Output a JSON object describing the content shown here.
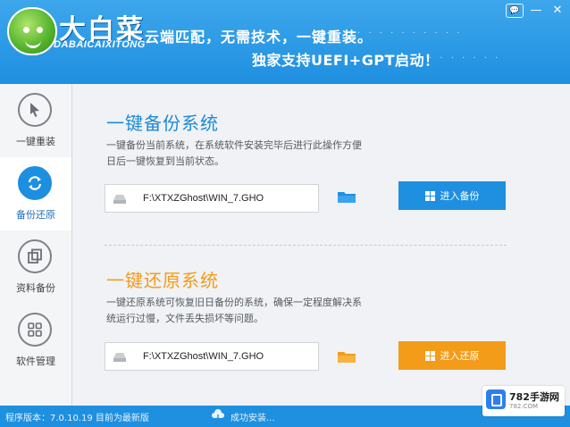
{
  "header": {
    "logo_text": "大白菜",
    "logo_subtitle": "DABAICAIXITONG",
    "slogan_line1": "云端匹配，无需技术，一键重装。",
    "slogan_line2": "独家支持UEFI+GPT启动！"
  },
  "window_controls": {
    "chat": "💬",
    "minimize": "—",
    "close": "✕"
  },
  "sidebar": {
    "items": [
      {
        "label": "一键重装",
        "icon": "cursor-icon",
        "active": false
      },
      {
        "label": "备份还原",
        "icon": "sync-icon",
        "active": true
      },
      {
        "label": "资料备份",
        "icon": "copy-icon",
        "active": false
      },
      {
        "label": "软件管理",
        "icon": "grid-icon",
        "active": false
      }
    ]
  },
  "backup": {
    "title": "一键备份系统",
    "description": "一键备份当前系统，在系统软件安装完毕后进行此操作方便日后一键恢复到当前状态。",
    "path": "F:\\XTXZGhost\\WIN_7.GHO",
    "button_label": "进入备份"
  },
  "restore": {
    "title": "一键还原系统",
    "description": "一键还原系统可恢复旧日备份的系统，确保一定程度解决系统运行过慢，文件丢失损坏等问题。",
    "path": "F:\\XTXZGhost\\WIN_7.GHO",
    "button_label": "进入还原"
  },
  "status_bar": {
    "version": "程序版本：7.0.10.19 目前为最新版",
    "hint": "成功安装..."
  },
  "watermark": {
    "title": "782手游网",
    "subtitle": "782.COM"
  },
  "colors": {
    "primary": "#1f8fe0",
    "accent": "#f39c1a",
    "sidebar_bg": "#f4f5f7"
  }
}
